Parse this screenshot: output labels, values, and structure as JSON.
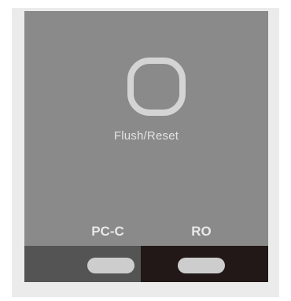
{
  "panel": {
    "flush_button": {
      "icon": "rounded-square-ring-icon",
      "label": "Flush/Reset"
    },
    "modes": [
      {
        "label": "PC-C",
        "indicator_color": "#cdcdcd",
        "cell_color": "#545454"
      },
      {
        "label": "RO",
        "indicator_color": "#cdcdcd",
        "cell_color": "#221818"
      }
    ]
  },
  "colors": {
    "panel_background": "#8a8a8a",
    "bezel": "#ebebeb",
    "label_text": "#e3e3e3"
  }
}
